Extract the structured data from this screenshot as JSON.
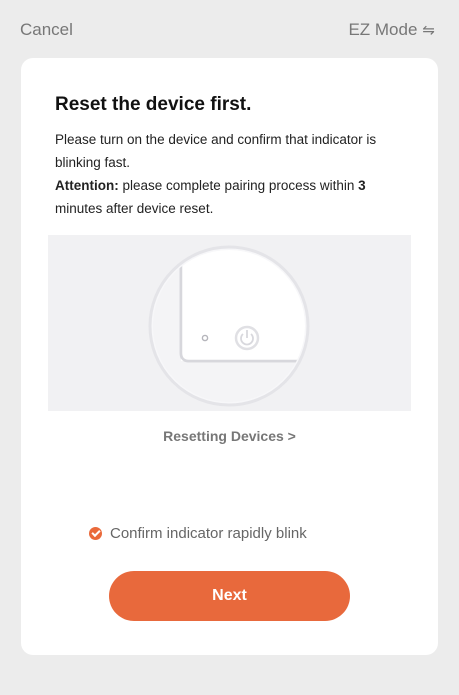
{
  "topbar": {
    "cancel_label": "Cancel",
    "mode_label": "EZ Mode",
    "mode_icon": "⇋"
  },
  "card": {
    "title": "Reset the device first.",
    "description": "Please turn on the device and confirm that indicator is blinking fast.",
    "attention_label": "Attention:",
    "attention_pre": "please complete pairing process within",
    "attention_minutes": "3",
    "attention_post": "minutes after device reset.",
    "reset_link": "Resetting Devices >",
    "confirm_label": "Confirm indicator rapidly blink",
    "next_label": "Next"
  },
  "colors": {
    "accent": "#e8693c",
    "background": "#ececec",
    "card": "#ffffff"
  }
}
